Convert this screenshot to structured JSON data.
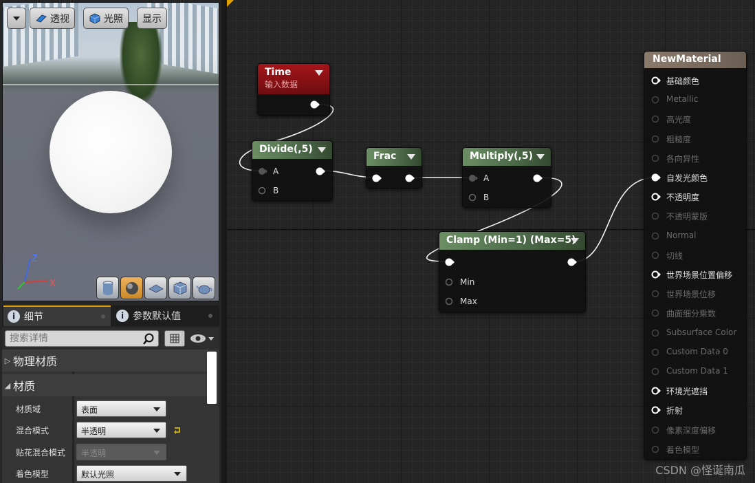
{
  "viewport": {
    "toolbar": {
      "menu_label": "",
      "perspective_label": "透视",
      "lighting_label": "光照",
      "show_label": "显示"
    },
    "axis": {
      "z": "Z",
      "x": "X"
    },
    "preview_shapes": [
      "cylinder",
      "sphere",
      "plane",
      "cube",
      "teapot"
    ]
  },
  "tabs": [
    {
      "label": "细节"
    },
    {
      "label": "参数默认值"
    }
  ],
  "search": {
    "placeholder": "搜索详情"
  },
  "details": {
    "categories": [
      {
        "label": "物理材质",
        "expanded": false
      },
      {
        "label": "材质",
        "expanded": true
      }
    ],
    "properties": [
      {
        "label": "材质域",
        "value": "表面",
        "enabled": true
      },
      {
        "label": "混合模式",
        "value": "半透明",
        "enabled": true
      },
      {
        "label": "贴花混合模式",
        "value": "半透明",
        "enabled": false
      },
      {
        "label": "着色模型",
        "value": "默认光照",
        "enabled": true
      }
    ]
  },
  "graph": {
    "nodes": {
      "time": {
        "title": "Time",
        "subtitle": "输入数据",
        "color": "#a5151a"
      },
      "divide": {
        "title": "Divide(,5)",
        "inputs": [
          "A",
          "B"
        ]
      },
      "frac": {
        "title": "Frac"
      },
      "multiply": {
        "title": "Multiply(,5)",
        "inputs": [
          "A",
          "B"
        ]
      },
      "clamp": {
        "title": "Clamp (Min=1) (Max=5)",
        "inputs": [
          "Min",
          "Max"
        ]
      },
      "material": {
        "title": "NewMaterial",
        "pins": [
          {
            "label": "基础颜色",
            "active": true
          },
          {
            "label": "Metallic",
            "active": false
          },
          {
            "label": "高光度",
            "active": false
          },
          {
            "label": "粗糙度",
            "active": false
          },
          {
            "label": "各向异性",
            "active": false
          },
          {
            "label": "自发光颜色",
            "active": true
          },
          {
            "label": "不透明度",
            "active": true
          },
          {
            "label": "不透明蒙版",
            "active": false
          },
          {
            "label": "Normal",
            "active": false
          },
          {
            "label": "切线",
            "active": false
          },
          {
            "label": "世界场景位置偏移",
            "active": true
          },
          {
            "label": "世界场景位移",
            "active": false
          },
          {
            "label": "曲面细分乘数",
            "active": false
          },
          {
            "label": "Subsurface Color",
            "active": false
          },
          {
            "label": "Custom Data 0",
            "active": false
          },
          {
            "label": "Custom Data 1",
            "active": false
          },
          {
            "label": "环境光遮挡",
            "active": true
          },
          {
            "label": "折射",
            "active": true
          },
          {
            "label": "像素深度偏移",
            "active": false
          },
          {
            "label": "着色模型",
            "active": false
          }
        ]
      }
    }
  },
  "watermark": "CSDN @怪诞南瓜",
  "colors": {
    "accent": "#e0a200",
    "node_green": "#4b6948",
    "node_red": "#a5151a",
    "material_header": "#7a6d60"
  }
}
